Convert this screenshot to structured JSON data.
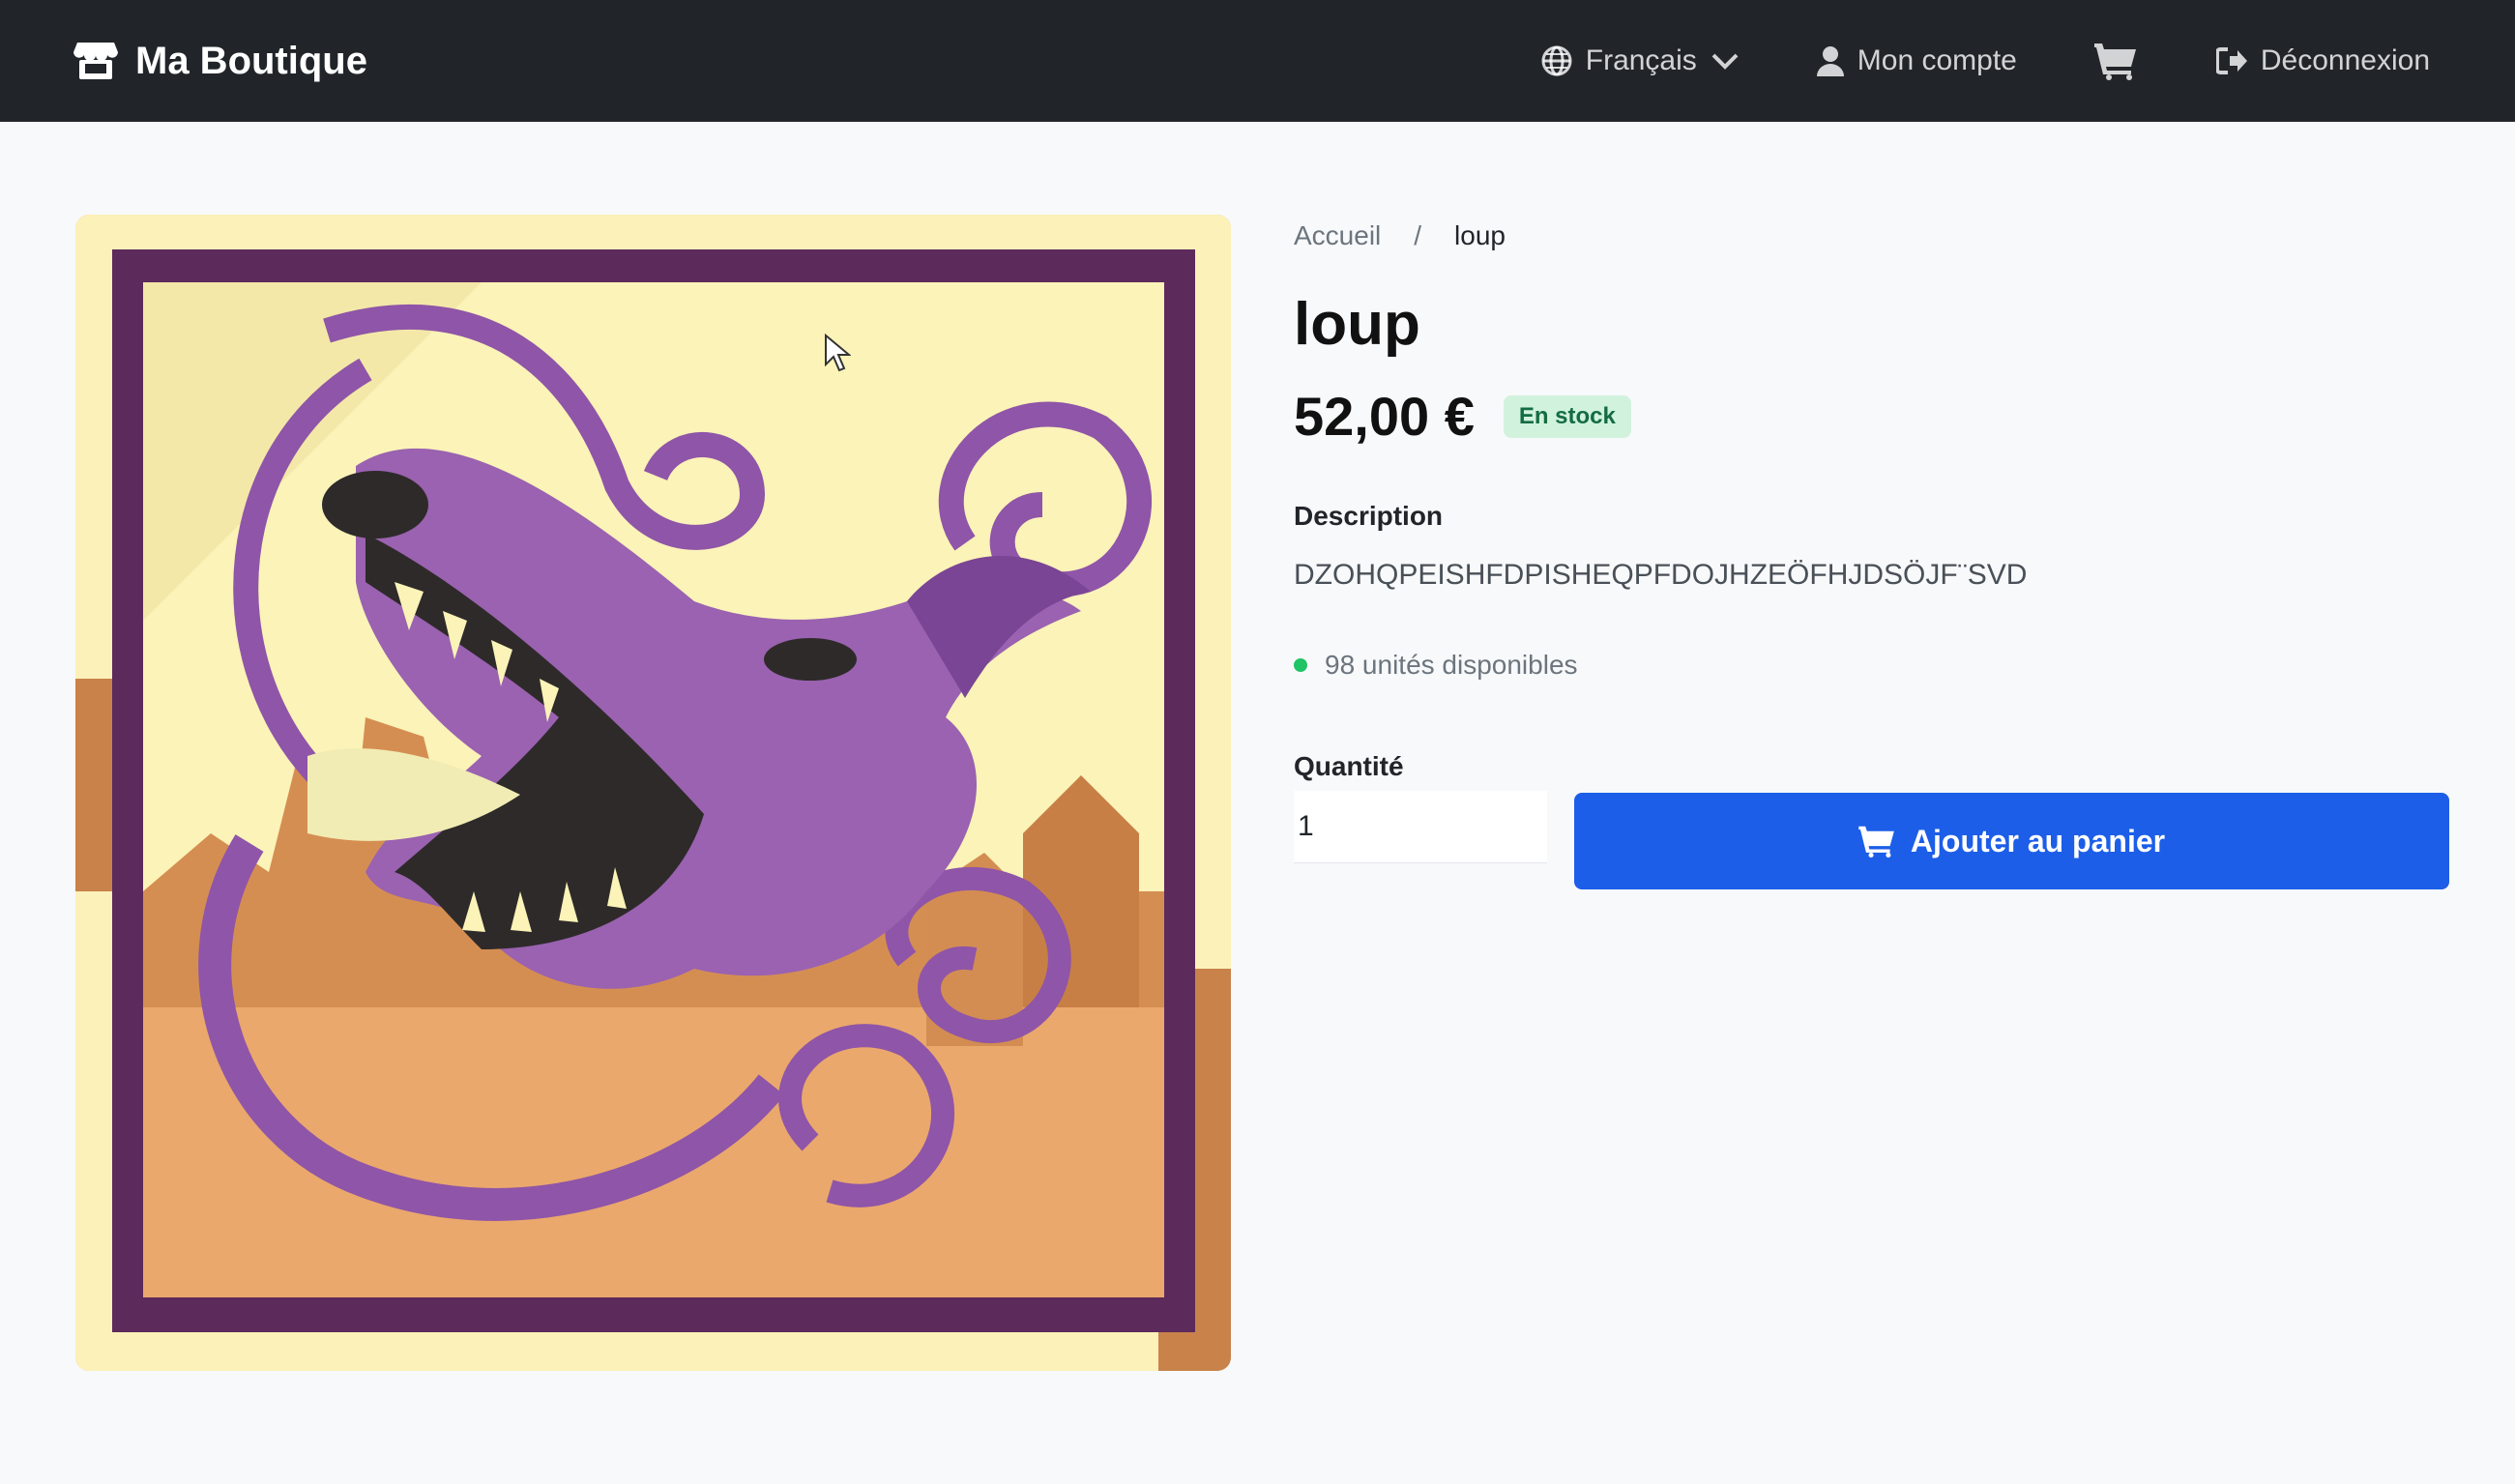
{
  "navbar": {
    "brand": "Ma Boutique",
    "language": "Français",
    "account": "Mon compte",
    "logout": "Déconnexion"
  },
  "product": {
    "image_alt_icon": "wolf-illustration",
    "breadcrumb": {
      "home": "Accueil",
      "separator": "/",
      "current": "loup"
    },
    "title": "loup",
    "price": "52,00 €",
    "stock_badge": "En stock",
    "description_label": "Description",
    "description": "DZOHQPEISHFDPISHEQPFDOJHZEÖFHJDSÖJF¨SVD",
    "stock_text": "98 unités disponibles",
    "quantity_label": "Quantité",
    "quantity_value": "1",
    "add_to_cart": "Ajouter au panier"
  },
  "colors": {
    "navbar_bg": "#212529",
    "primary_button": "#1c5ee8",
    "stock_badge_bg": "#d1f2dc",
    "stock_dot": "#20c464"
  }
}
